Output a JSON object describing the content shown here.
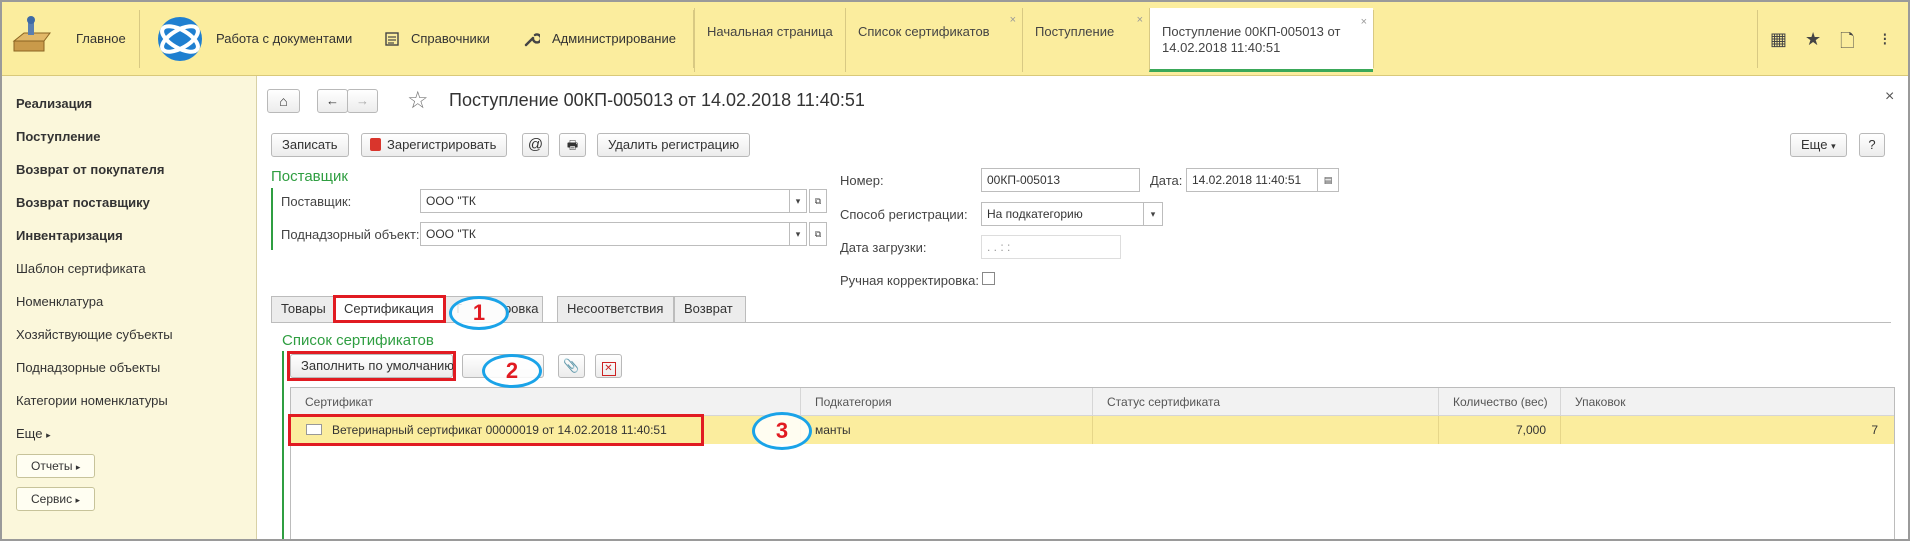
{
  "topbar": {
    "home_label": "Главное",
    "sections": [
      {
        "label": "Работа с документами",
        "icon": "documents-logo-icon"
      },
      {
        "label": "Справочники",
        "icon": "reference-books-icon"
      },
      {
        "label": "Администрирование",
        "icon": "wrench-icon"
      }
    ],
    "tabs": [
      {
        "label": "Начальная страница",
        "closable": false,
        "active": false
      },
      {
        "label": "Список сертификатов",
        "closable": true,
        "active": false
      },
      {
        "label": "Поступление",
        "closable": true,
        "active": false
      },
      {
        "label": "Поступление 00КП-005013 от 14.02.2018 11:40:51",
        "closable": true,
        "active": true
      }
    ],
    "right_icons": {
      "apps": "▦",
      "star": "★",
      "history": "🗋",
      "menu": "⁝"
    }
  },
  "sidebar": {
    "items": [
      {
        "label": "Реализация",
        "bold": true
      },
      {
        "label": "Поступление",
        "bold": true
      },
      {
        "label": "Возврат от покупателя",
        "bold": true
      },
      {
        "label": "Возврат поставщику",
        "bold": true
      },
      {
        "label": "Инвентаризация",
        "bold": true
      },
      {
        "label": "Шаблон сертификата",
        "bold": false
      },
      {
        "label": "Номенклатура",
        "bold": false
      },
      {
        "label": "Хозяйствующие субъекты",
        "bold": false
      },
      {
        "label": "Поднадзорные объекты",
        "bold": false
      },
      {
        "label": "Категории номенклатуры",
        "bold": false
      }
    ],
    "more_label": "Еще",
    "reports_label": "Отчеты",
    "service_label": "Сервис"
  },
  "doc": {
    "title": "Поступление 00КП-005013 от 14.02.2018 11:40:51",
    "close_glyph": "×",
    "toolbar": {
      "save": "Записать",
      "register": "Зарегистрировать",
      "email": "@",
      "print": "🖶",
      "unregister": "Удалить регистрацию",
      "more": "Еще",
      "help": "?"
    },
    "supplier_group": "Поставщик",
    "supplier_label": "Поставщик:",
    "supplier_value": "ООО \"ТК",
    "object_label": "Поднадзорный объект:",
    "object_value": "ООО \"ТК",
    "number_label": "Номер:",
    "number_value": "00КП-005013",
    "date_label": "Дата:",
    "date_value": "14.02.2018 11:40:51",
    "reg_method_label": "Способ регистрации:",
    "reg_method_value": "На подкатегорию",
    "load_date_label": "Дата загрузки:",
    "load_date_value": " .  .      :  :",
    "manual_label": "Ручная корректировка:"
  },
  "tabs": {
    "items": [
      {
        "label": "Товары"
      },
      {
        "label": "Сертификация"
      },
      {
        "label": "Т"
      },
      {
        "label": "ровка"
      },
      {
        "label": "Несоответствия"
      },
      {
        "label": "Возврат"
      }
    ]
  },
  "certs": {
    "group_title": "Список сертификатов",
    "fill_default": "Заполнить по умолчанию",
    "columns": [
      "Сертификат",
      "Подкатегория",
      "Статус сертификата",
      "Количество (вес)",
      "Упаковок"
    ],
    "rows": [
      {
        "certificate": "Ветеринарный сертификат 00000019 от 14.02.2018 11:40:51",
        "subcategory": "манты",
        "status": "",
        "quantity": "7,000",
        "packages": "7"
      }
    ]
  },
  "annotations": [
    "1",
    "2",
    "3"
  ],
  "colors": {
    "topbar_bg": "#fbed9e",
    "sidebar_bg": "#fbf7db",
    "accent_green": "#2f9e41",
    "highlight_red": "#e11b22",
    "highlight_blue": "#1aa3e8",
    "selected_row": "#fbed9e"
  }
}
